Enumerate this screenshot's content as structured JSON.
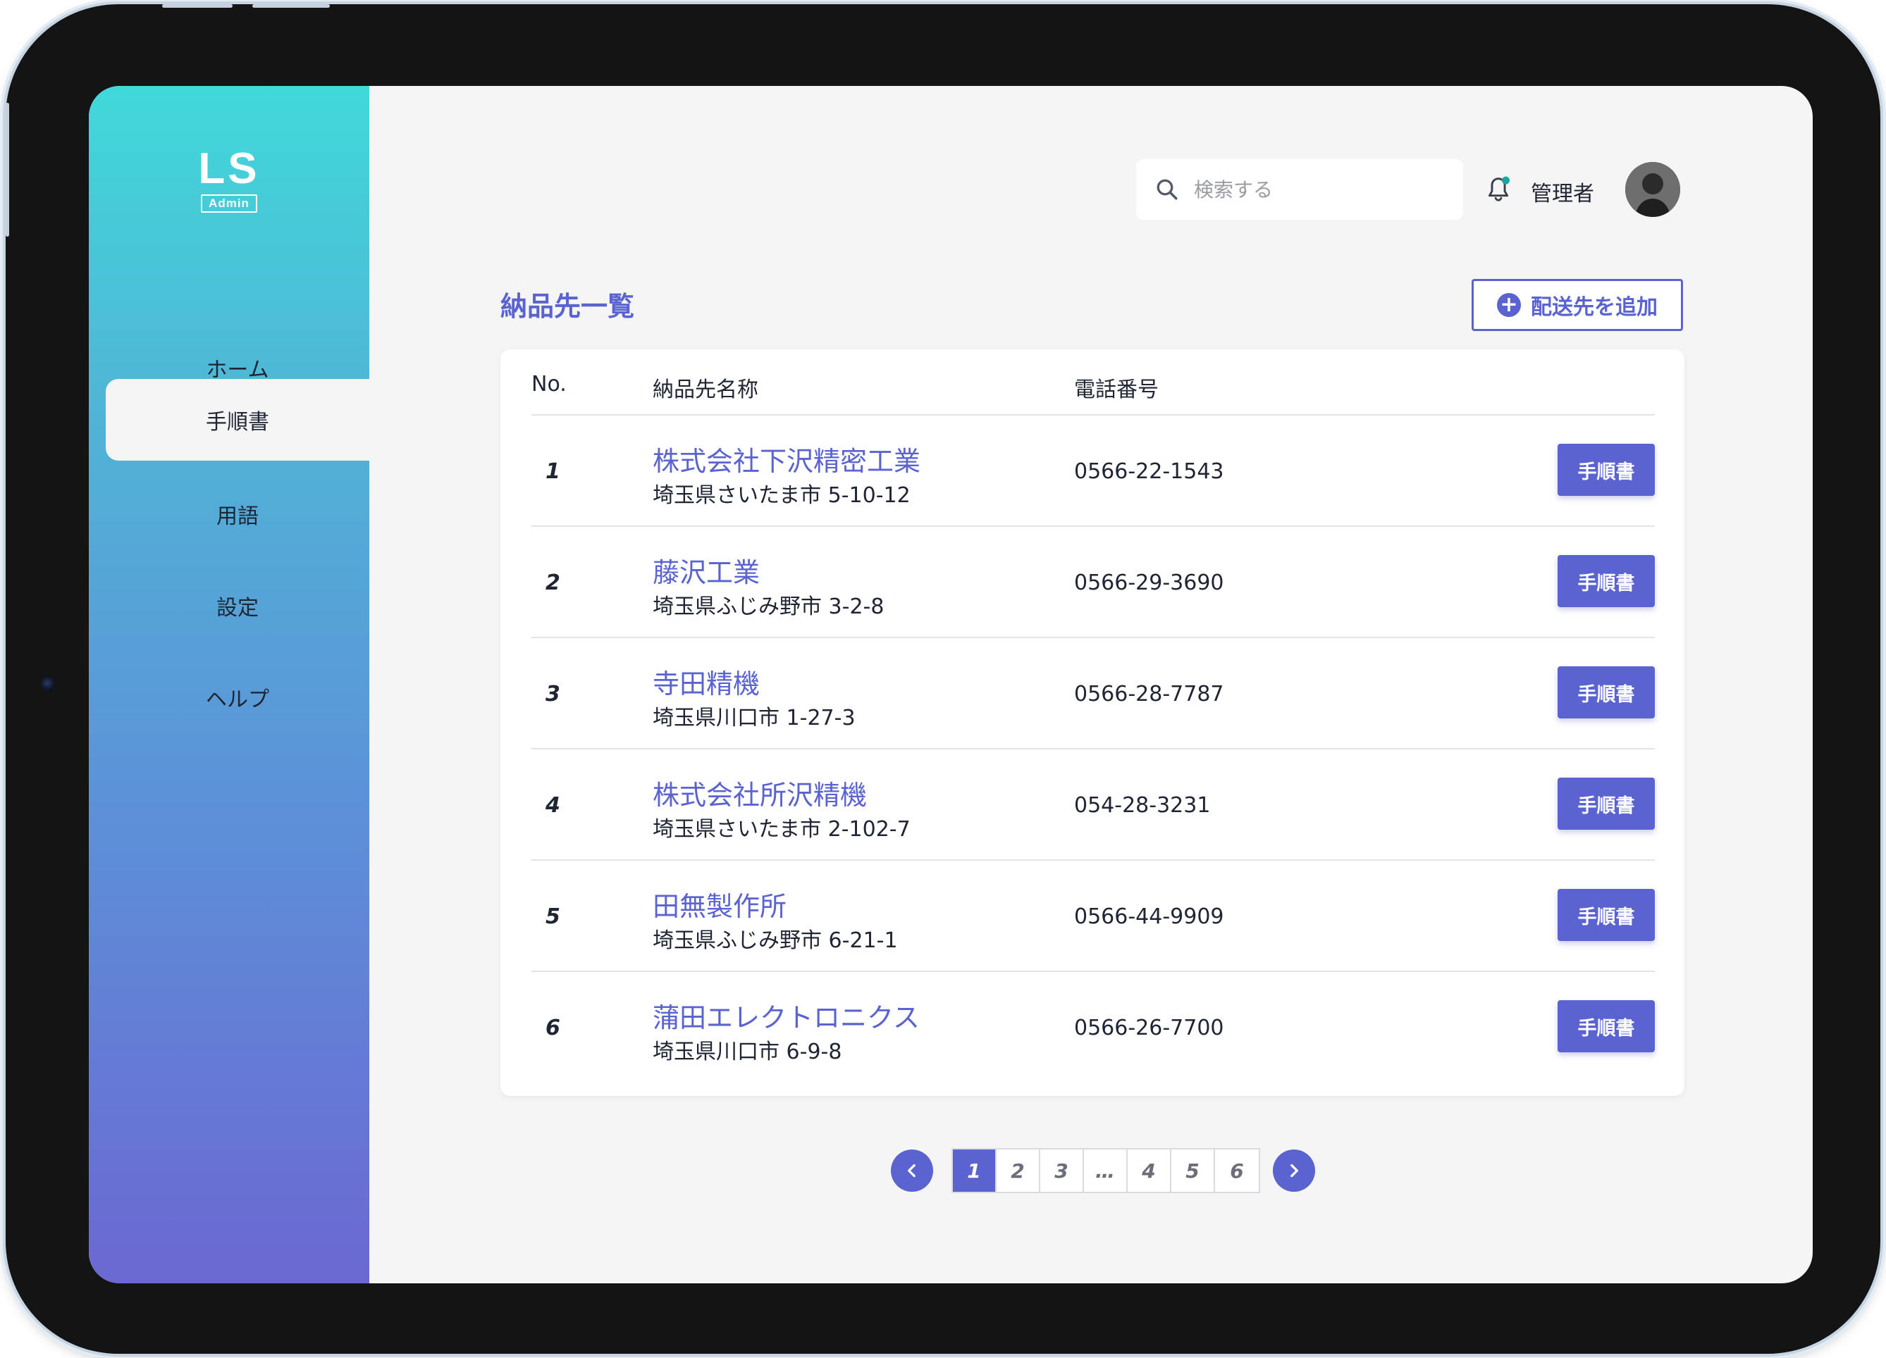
{
  "sidebar": {
    "logo": {
      "title": "LS",
      "subtitle": "Admin"
    },
    "items": [
      {
        "label": "ホーム",
        "active": false
      },
      {
        "label": "手順書",
        "active": true
      },
      {
        "label": "用語",
        "active": false
      },
      {
        "label": "設定",
        "active": false
      },
      {
        "label": "ヘルプ",
        "active": false
      }
    ]
  },
  "header": {
    "search_placeholder": "検索する",
    "user_name": "管理者"
  },
  "page": {
    "title": "納品先一覧",
    "add_button_label": "配送先を追加"
  },
  "table": {
    "columns": {
      "no": "No.",
      "name": "納品先名称",
      "phone": "電話番号"
    },
    "rows": [
      {
        "no": "1",
        "name": "株式会社下沢精密工業",
        "address": "埼玉県さいたま市 5-10-12",
        "phone": "0566-22-1543",
        "action": "手順書"
      },
      {
        "no": "2",
        "name": "藤沢工業",
        "address": "埼玉県ふじみ野市 3-2-8",
        "phone": "0566-29-3690",
        "action": "手順書"
      },
      {
        "no": "3",
        "name": "寺田精機",
        "address": "埼玉県川口市 1-27-3",
        "phone": "0566-28-7787",
        "action": "手順書"
      },
      {
        "no": "4",
        "name": "株式会社所沢精機",
        "address": "埼玉県さいたま市 2-102-7",
        "phone": "054-28-3231",
        "action": "手順書"
      },
      {
        "no": "5",
        "name": "田無製作所",
        "address": "埼玉県ふじみ野市 6-21-1",
        "phone": "0566-44-9909",
        "action": "手順書"
      },
      {
        "no": "6",
        "name": "蒲田エレクトロニクス",
        "address": "埼玉県川口市 6-9-8",
        "phone": "0566-26-7700",
        "action": "手順書"
      }
    ]
  },
  "pagination": {
    "pages": [
      "1",
      "2",
      "3",
      "…",
      "4",
      "5",
      "6"
    ],
    "current": "1"
  },
  "colors": {
    "accent": "#5a63cf",
    "sidebar_gradient_top": "#40d9da",
    "sidebar_gradient_bottom": "#6b68d2",
    "notification_dot": "#1aa6a0"
  }
}
